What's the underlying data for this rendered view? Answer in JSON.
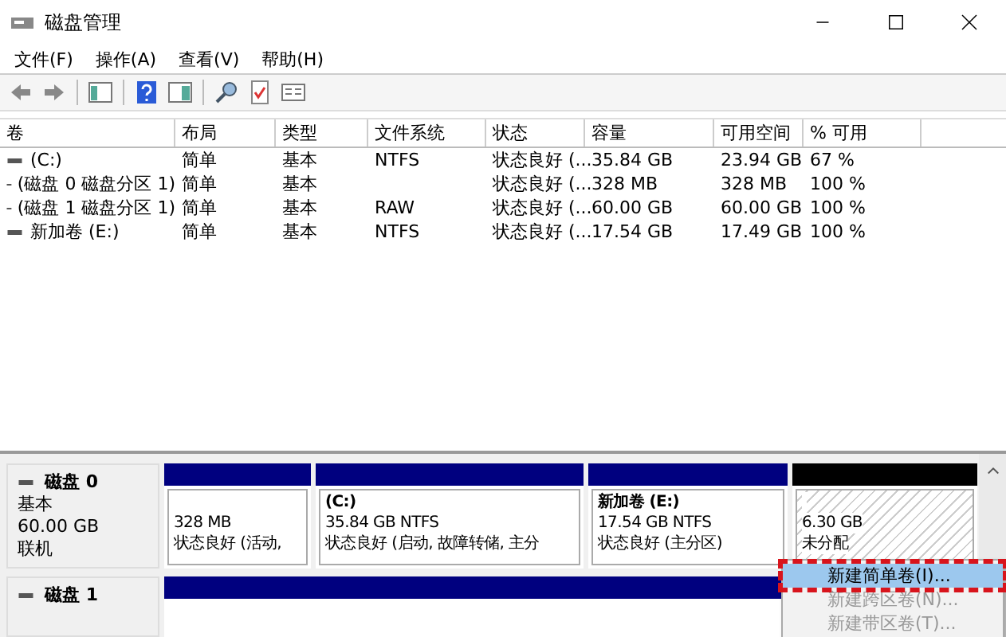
{
  "window": {
    "title": "磁盘管理"
  },
  "menu": [
    "文件(F)",
    "操作(A)",
    "查看(V)",
    "帮助(H)"
  ],
  "table": {
    "columns": [
      "卷",
      "布局",
      "类型",
      "文件系统",
      "状态",
      "容量",
      "可用空间",
      "% 可用"
    ],
    "rows": [
      [
        "(C:)",
        "简单",
        "基本",
        "NTFS",
        "状态良好 (...",
        "35.84 GB",
        "23.94 GB",
        "67 %"
      ],
      [
        "(磁盘 0 磁盘分区 1)",
        "简单",
        "基本",
        "",
        "状态良好 (...",
        "328 MB",
        "328 MB",
        "100 %"
      ],
      [
        "(磁盘 1 磁盘分区 1)",
        "简单",
        "基本",
        "RAW",
        "状态良好 (...",
        "60.00 GB",
        "60.00 GB",
        "100 %"
      ],
      [
        "新加卷 (E:)",
        "简单",
        "基本",
        "NTFS",
        "状态良好 (...",
        "17.54 GB",
        "17.49 GB",
        "100 %"
      ]
    ]
  },
  "disks": [
    {
      "name": "磁盘 0",
      "type": "基本",
      "size": "60.00 GB",
      "status": "联机",
      "partitions": [
        {
          "kind": "primary",
          "size": "328 MB",
          "status": "状态良好 (活动,"
        },
        {
          "kind": "primary",
          "label": "(C:)",
          "size": "35.84 GB NTFS",
          "status": "状态良好 (启动, 故障转储, 主分"
        },
        {
          "kind": "primary",
          "label": "新加卷  (E:)",
          "size": "17.54 GB NTFS",
          "status": "状态良好 (主分区)"
        },
        {
          "kind": "unallocated",
          "size": "6.30 GB",
          "status": "未分配"
        }
      ]
    },
    {
      "name": "磁盘 1",
      "partitions": [
        {
          "kind": "primary"
        }
      ]
    }
  ],
  "context_menu": [
    {
      "label": "新建简单卷(I)...",
      "selected": true,
      "disabled": false
    },
    {
      "label": "新建跨区卷(N)...",
      "selected": false,
      "disabled": true
    },
    {
      "label": "新建带区卷(T)...",
      "selected": false,
      "disabled": true
    }
  ]
}
